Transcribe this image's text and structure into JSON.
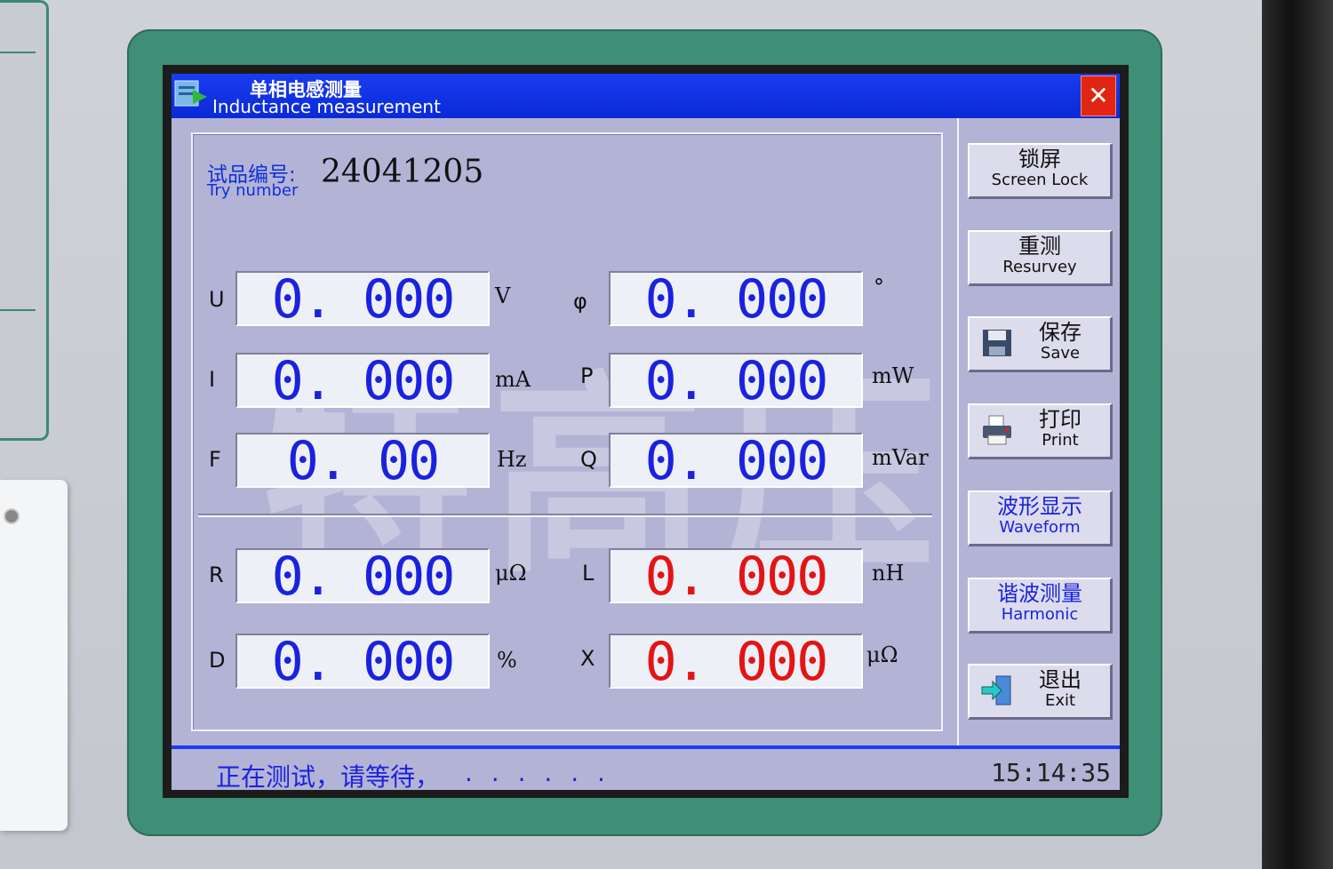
{
  "window": {
    "title_cn": "单相电感测量",
    "title_en": "Inductance measurement",
    "close_label": "✕"
  },
  "try_number": {
    "label_cn": "试品编号:",
    "label_en": "Try number",
    "value": "24041205"
  },
  "measurements": {
    "U": {
      "label": "U",
      "value": "0. 000",
      "unit": "V"
    },
    "phi": {
      "label": "φ",
      "value": "0. 000",
      "unit": "°"
    },
    "I": {
      "label": "I",
      "value": "0. 000",
      "unit": "mA"
    },
    "P": {
      "label": "P",
      "value": "0. 000",
      "unit": "mW"
    },
    "F": {
      "label": "F",
      "value": "0. 00",
      "unit": "Hz"
    },
    "Q": {
      "label": "Q",
      "value": "0. 000",
      "unit": "mVar"
    },
    "R": {
      "label": "R",
      "value": "0. 000",
      "unit": "μΩ"
    },
    "L": {
      "label": "L",
      "value": "0. 000",
      "unit": "nH"
    },
    "D": {
      "label": "D",
      "value": "0. 000",
      "unit": "%"
    },
    "X": {
      "label": "X",
      "value": "0. 000",
      "unit": "μΩ"
    }
  },
  "buttons": {
    "screen_lock": {
      "cn": "锁屏",
      "en": "Screen Lock"
    },
    "resurvey": {
      "cn": "重测",
      "en": "Resurvey"
    },
    "save": {
      "cn": "保存",
      "en": "Save"
    },
    "print": {
      "cn": "打印",
      "en": "Print"
    },
    "waveform": {
      "cn": "波形显示",
      "en": "Waveform"
    },
    "harmonic": {
      "cn": "谐波测量",
      "en": "Harmonic"
    },
    "exit": {
      "cn": "退出",
      "en": "Exit"
    }
  },
  "status": {
    "message": "正在测试，请等待，",
    "dots": ". . .   . . .",
    "time": "15:14:35"
  },
  "colors": {
    "titlebar": "#0a2ad8",
    "screen_bg": "#b3b3d6",
    "value_blue": "#1a22e0",
    "value_red": "#e41414",
    "frame_green": "#3f8e76"
  }
}
